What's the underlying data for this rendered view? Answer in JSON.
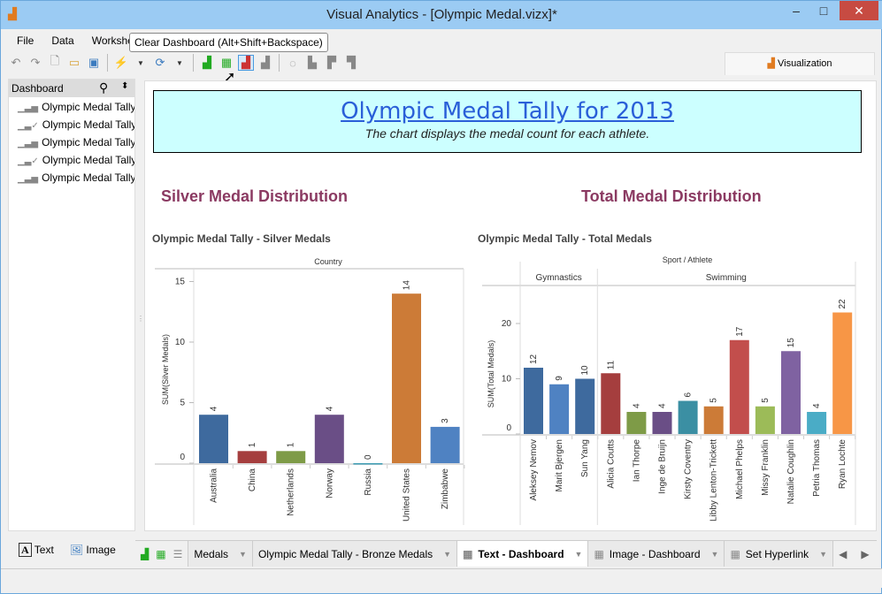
{
  "window": {
    "title": "Visual Analytics - [Olympic Medal.vizx]*",
    "minimize": "–",
    "maximize": "□",
    "close": "✕"
  },
  "menu": [
    "File",
    "Data",
    "Workshee"
  ],
  "tooltip": "Clear Dashboard (Alt+Shift+Backspace)",
  "visualization_tab": "Visualization",
  "left_panel": {
    "title": "Dashboard",
    "items": [
      "Olympic Medal Tally",
      "Olympic Medal Tally ...",
      "Olympic Medal Tally ...",
      "Olympic Medal Tally ...",
      "Olympic Medal Tally ..."
    ],
    "text_button": "Text",
    "image_button": "Image"
  },
  "header": {
    "title": "Olympic Medal Tally for 2013",
    "subtitle": "The chart displays the medal count for each athlete.",
    "background": "#ccffff"
  },
  "sections": {
    "left": "Silver Medal Distribution",
    "right": "Total Medal Distribution"
  },
  "tabs": [
    {
      "label": "Medals",
      "active": false
    },
    {
      "label": "Olympic Medal Tally - Bronze Medals",
      "active": false
    },
    {
      "label": "Text - Dashboard",
      "active": true
    },
    {
      "label": "Image - Dashboard",
      "active": false
    },
    {
      "label": "Set Hyperlink",
      "active": false
    }
  ],
  "chart_data": [
    {
      "type": "bar",
      "title": "Olympic Medal Tally - Silver Medals",
      "column_header": "Country",
      "ylabel": "SUM(Silver Medals)",
      "ylim": [
        0,
        15
      ],
      "yticks": [
        0,
        5,
        10,
        15
      ],
      "categories": [
        "Australia",
        "China",
        "Netherlands",
        "Norway",
        "Russia",
        "United States",
        "Zimbabwe"
      ],
      "values": [
        4,
        1,
        1,
        4,
        0,
        14,
        3
      ],
      "colors": [
        "#3e6a9e",
        "#a53e3e",
        "#7e9b47",
        "#6a4e86",
        "#3b9bb2",
        "#cc7b37",
        "#4f82c2"
      ]
    },
    {
      "type": "bar",
      "title": "Olympic Medal Tally - Total Medals",
      "column_header": "Sport / Athlete",
      "ylabel": "SUM(Total Medals)",
      "yticks": [
        0,
        10,
        20
      ],
      "groups": [
        {
          "name": "Gymnastics",
          "count": 3
        },
        {
          "name": "Swimming",
          "count": 10
        }
      ],
      "categories": [
        "Aleksey Nemov",
        "Marit Bjergen",
        "Sun Yang",
        "Alicia Coutts",
        "Ian Thorpe",
        "Inge de Bruijn",
        "Kirsty Coventry",
        "Libby Lenton-Trickett",
        "Michael Phelps",
        "Missy Franklin",
        "Natalie Coughlin",
        "Petria Thomas",
        "Ryan Lochte"
      ],
      "values": [
        12,
        9,
        10,
        11,
        4,
        4,
        6,
        5,
        17,
        5,
        15,
        4,
        22
      ],
      "colors": [
        "#3e6a9e",
        "#4f82c2",
        "#3e6a9e",
        "#a53e3e",
        "#7e9b47",
        "#6a4e86",
        "#3b8fa3",
        "#cc7b37",
        "#c24e4c",
        "#9cbb58",
        "#7f62a1",
        "#4aacc6",
        "#f79646"
      ]
    }
  ]
}
